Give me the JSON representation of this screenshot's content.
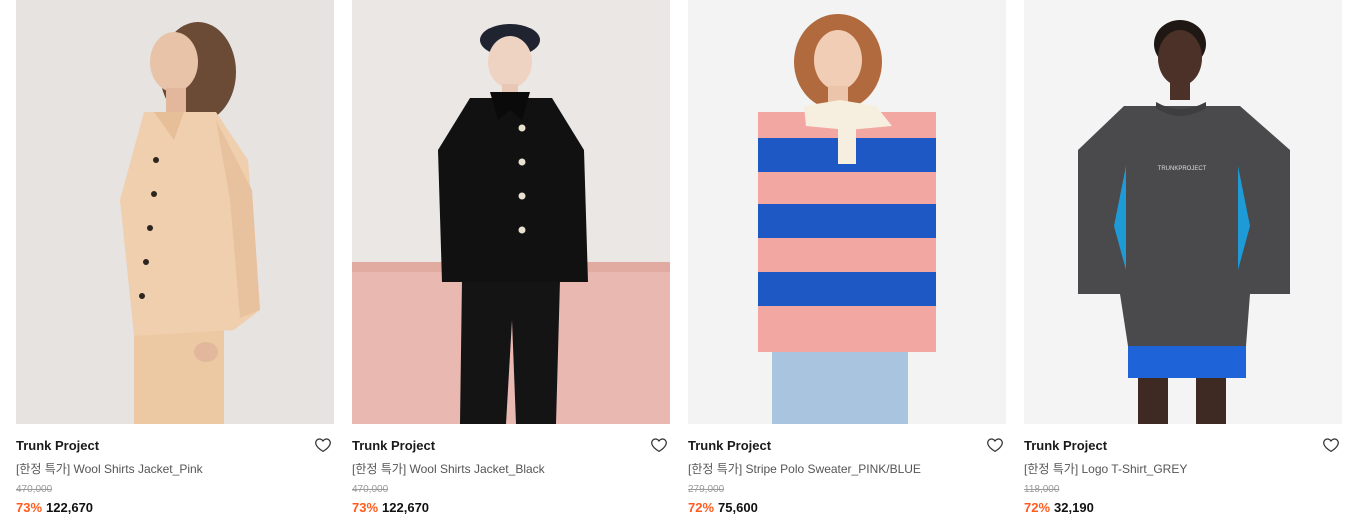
{
  "products": [
    {
      "brand": "Trunk Project",
      "name": "[한정 특가] Wool Shirts Jacket_Pink",
      "original_price": "470,000",
      "discount": "73%",
      "price": "122,670",
      "image_alt": "model in pink wool shirts jacket",
      "colors": {
        "bg": "#e9e6e4",
        "garment": "#f0cfae"
      }
    },
    {
      "brand": "Trunk Project",
      "name": "[한정 특가] Wool Shirts Jacket_Black",
      "original_price": "470,000",
      "discount": "73%",
      "price": "122,670",
      "image_alt": "model in black wool shirts jacket",
      "colors": {
        "bg": "#ebe7e5",
        "garment": "#141414"
      }
    },
    {
      "brand": "Trunk Project",
      "name": "[한정 특가] Stripe Polo Sweater_PINK/BLUE",
      "original_price": "279,000",
      "discount": "72%",
      "price": "75,600",
      "image_alt": "model in pink and blue stripe polo sweater",
      "colors": {
        "bg": "#f3f3f3",
        "stripe_a": "#f2a7a3",
        "stripe_b": "#1d58c4"
      }
    },
    {
      "brand": "Trunk Project",
      "name": "[한정 특가] Logo T-Shirt_GREY",
      "original_price": "118,000",
      "discount": "72%",
      "price": "32,190",
      "image_alt": "model in grey logo t-shirt",
      "logo_text": "TRUNKPROJECT",
      "colors": {
        "bg": "#f4f4f4",
        "garment": "#4a4a4c",
        "accent": "#1e9ad6"
      }
    }
  ],
  "icons": {
    "wishlist": "heart-outline-icon"
  }
}
